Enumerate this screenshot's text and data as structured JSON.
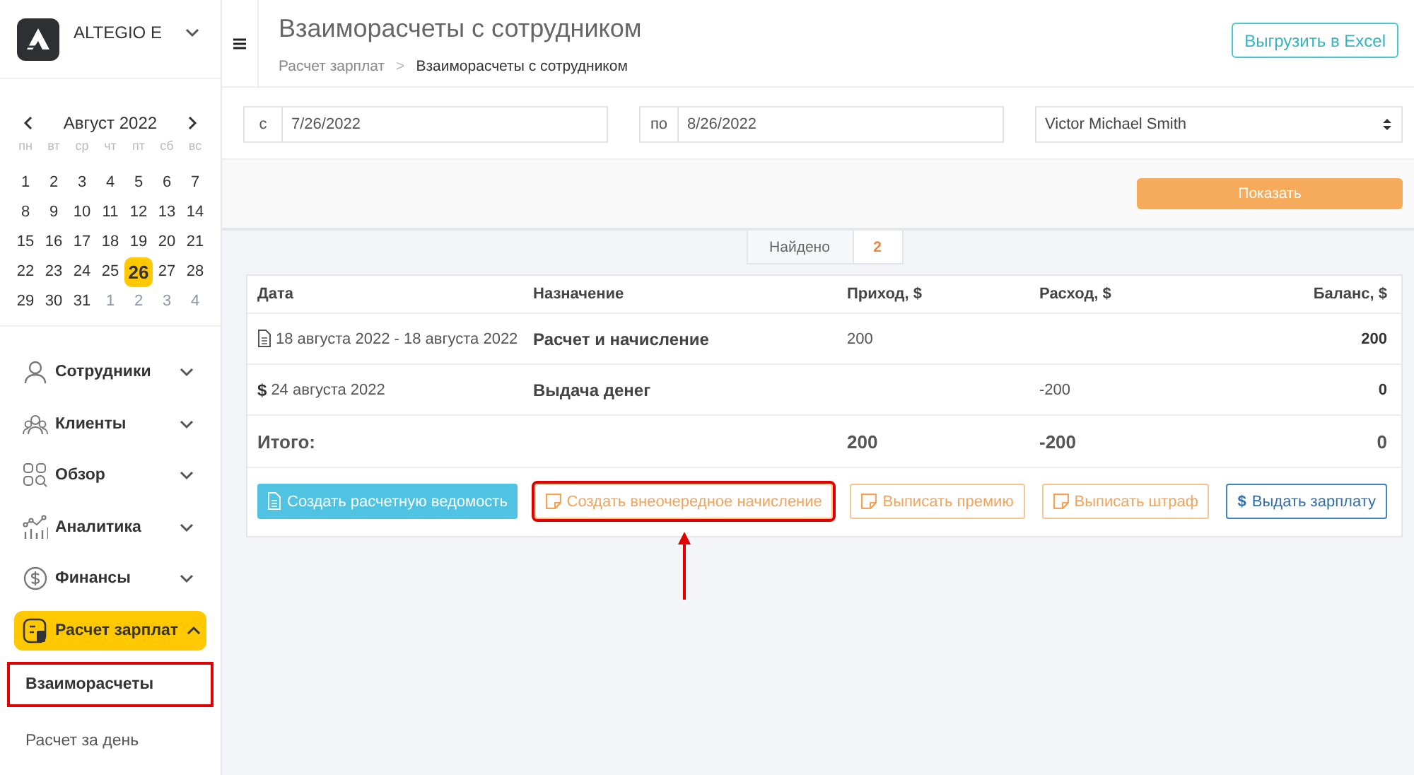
{
  "sidebar": {
    "company": "ALTEGIO E",
    "calendar": {
      "month": "Август 2022",
      "weekdays": [
        "пн",
        "вт",
        "ср",
        "чт",
        "пт",
        "сб",
        "вс"
      ],
      "days": [
        {
          "label": "1",
          "selected": false,
          "outside": false
        },
        {
          "label": "2",
          "selected": false,
          "outside": false
        },
        {
          "label": "3",
          "selected": false,
          "outside": false
        },
        {
          "label": "4",
          "selected": false,
          "outside": false
        },
        {
          "label": "5",
          "selected": false,
          "outside": false
        },
        {
          "label": "6",
          "selected": false,
          "outside": false
        },
        {
          "label": "7",
          "selected": false,
          "outside": false
        },
        {
          "label": "8",
          "selected": false,
          "outside": false
        },
        {
          "label": "9",
          "selected": false,
          "outside": false
        },
        {
          "label": "10",
          "selected": false,
          "outside": false
        },
        {
          "label": "11",
          "selected": false,
          "outside": false
        },
        {
          "label": "12",
          "selected": false,
          "outside": false
        },
        {
          "label": "13",
          "selected": false,
          "outside": false
        },
        {
          "label": "14",
          "selected": false,
          "outside": false
        },
        {
          "label": "15",
          "selected": false,
          "outside": false
        },
        {
          "label": "16",
          "selected": false,
          "outside": false
        },
        {
          "label": "17",
          "selected": false,
          "outside": false
        },
        {
          "label": "18",
          "selected": false,
          "outside": false
        },
        {
          "label": "19",
          "selected": false,
          "outside": false
        },
        {
          "label": "20",
          "selected": false,
          "outside": false
        },
        {
          "label": "21",
          "selected": false,
          "outside": false
        },
        {
          "label": "22",
          "selected": false,
          "outside": false
        },
        {
          "label": "23",
          "selected": false,
          "outside": false
        },
        {
          "label": "24",
          "selected": false,
          "outside": false
        },
        {
          "label": "25",
          "selected": false,
          "outside": false
        },
        {
          "label": "26",
          "selected": true,
          "outside": false
        },
        {
          "label": "27",
          "selected": false,
          "outside": false
        },
        {
          "label": "28",
          "selected": false,
          "outside": false
        },
        {
          "label": "29",
          "selected": false,
          "outside": false
        },
        {
          "label": "30",
          "selected": false,
          "outside": false
        },
        {
          "label": "31",
          "selected": false,
          "outside": false
        },
        {
          "label": "1",
          "selected": false,
          "outside": true
        },
        {
          "label": "2",
          "selected": false,
          "outside": true
        },
        {
          "label": "3",
          "selected": false,
          "outside": true
        },
        {
          "label": "4",
          "selected": false,
          "outside": true
        }
      ]
    },
    "items": [
      {
        "label": "Сотрудники",
        "kind": "person",
        "selected": false,
        "expanded": false
      },
      {
        "label": "Клиенты",
        "kind": "people",
        "selected": false,
        "expanded": false
      },
      {
        "label": "Обзор",
        "kind": "overview",
        "selected": false,
        "expanded": false
      },
      {
        "label": "Аналитика",
        "kind": "chart",
        "selected": false,
        "expanded": false
      },
      {
        "label": "Финансы",
        "kind": "money",
        "selected": false,
        "expanded": false
      },
      {
        "label": "Расчет зарплат",
        "kind": "payroll",
        "selected": true,
        "expanded": true,
        "children": [
          {
            "label": "Взаиморасчеты",
            "selected": true,
            "highlighted": true
          },
          {
            "label": "Расчет за день",
            "selected": false,
            "highlighted": false
          }
        ]
      }
    ]
  },
  "header": {
    "title": "Взаиморасчеты с сотрудником",
    "breadcrumb": [
      "Расчет зарплат",
      "Взаиморасчеты с сотрудником"
    ],
    "breadcrumb_separator": ">",
    "export_button": "Выгрузить в Excel"
  },
  "filters": {
    "from_label": "с",
    "from_value": "7/26/2022",
    "to_label": "по",
    "to_value": "8/26/2022",
    "employee": "Victor Michael Smith",
    "show_button": "Показать"
  },
  "found": {
    "label": "Найдено",
    "count": "2"
  },
  "table": {
    "columns": [
      "Дата",
      "Назначение",
      "Приход, $",
      "Расход, $",
      "Баланс, $"
    ],
    "rows": [
      {
        "kind": "document",
        "date": "18 августа 2022 - 18 августа 2022",
        "purpose": "Расчет и начисление",
        "income": "200",
        "expense": "",
        "balance": "200"
      },
      {
        "kind": "payment",
        "icon_text": "$",
        "date": "24 августа 2022",
        "purpose": "Выдача денег",
        "income": "",
        "expense": "-200",
        "balance": "0"
      }
    ],
    "total": {
      "label": "Итого:",
      "income": "200",
      "expense": "-200",
      "balance": "0"
    }
  },
  "actions": [
    {
      "kind": "primary",
      "label": "Создать расчетную ведомость",
      "highlighted": false,
      "arrow_below": false
    },
    {
      "kind": "note",
      "label": "Создать внеочередное начисление",
      "highlighted": true,
      "arrow_below": true
    },
    {
      "kind": "note",
      "label": "Выписать премию",
      "highlighted": false,
      "arrow_below": false
    },
    {
      "kind": "note",
      "label": "Выписать штраф",
      "highlighted": false,
      "arrow_below": false
    },
    {
      "kind": "payout",
      "icon_text": "$",
      "label": "Выдать зарплату",
      "highlighted": false,
      "arrow_below": false
    }
  ]
}
